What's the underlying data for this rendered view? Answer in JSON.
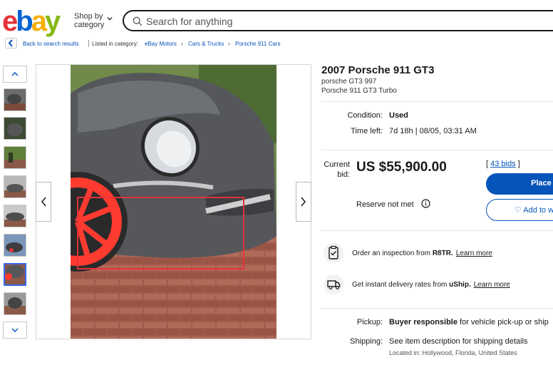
{
  "header": {
    "logo_letters": [
      "e",
      "b",
      "a",
      "y"
    ],
    "logo_colors": [
      "#e53238",
      "#0064d2",
      "#f5af02",
      "#86b817"
    ],
    "shop_by_line1": "Shop by",
    "shop_by_line2": "category",
    "search_placeholder": "Search for anything"
  },
  "breadcrumb": {
    "back": "Back to search results",
    "listed": "Listed in category:",
    "items": [
      "eBay Motors",
      "›",
      "Cars & Trucks",
      "›",
      "Porsche 911 Cars"
    ]
  },
  "listing": {
    "title": "2007 Porsche 911 GT3",
    "subtitle1": "porsche GT3 997",
    "subtitle2": "Porsche 911 GT3 Turbo",
    "condition_label": "Condition:",
    "condition_value": "Used",
    "time_label": "Time left:",
    "time_value": "7d 18h | 08/05, 03:31 AM",
    "bid_label_1": "Current",
    "bid_label_2": "bid:",
    "price": "US $55,900.00",
    "bids_open": "[ ",
    "bids_link": "43 bids",
    "bids_close": " ]",
    "place_bid": "Place",
    "watch": "♡ Add to w",
    "reserve": "Reserve not met"
  },
  "services": {
    "inspection_text": "Order an inspection from ",
    "inspection_brand": "R8TR.",
    "inspection_link": "Learn more",
    "delivery_text": "Get instant delivery rates from ",
    "delivery_brand": "uShip.",
    "delivery_link": "Learn more"
  },
  "shipping": {
    "pickup_label": "Pickup:",
    "pickup_bold": "Buyer responsible",
    "pickup_rest": " for vehicle pick-up or ship",
    "shipping_label": "Shipping:",
    "shipping_value": "See item description for shipping details",
    "location": "Located in: Hollywood, Florida, United States"
  },
  "colors": {
    "accent": "#0654ba",
    "highlight_box": "#e53238",
    "wheel": "#ff3b30",
    "car_body": "#55575b",
    "pavers": "#a15a4c"
  }
}
